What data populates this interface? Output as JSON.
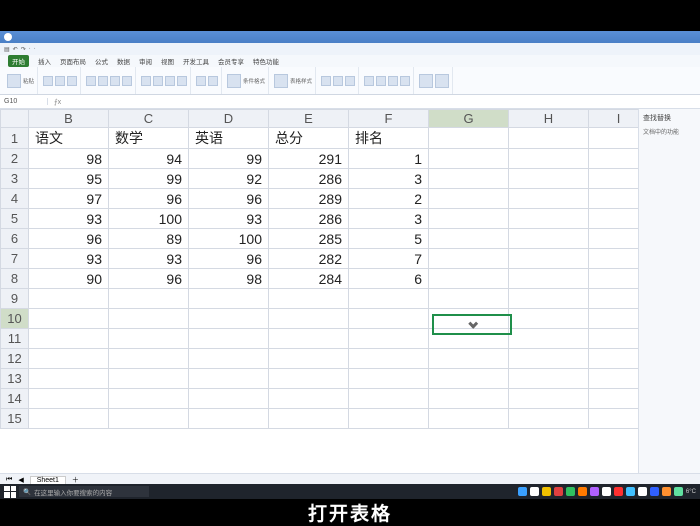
{
  "app": {
    "namebox": "G10",
    "formula": ""
  },
  "menus": [
    "开始",
    "插入",
    "页面布局",
    "公式",
    "数据",
    "审阅",
    "视图",
    "开发工具",
    "会员专享",
    "特色功能"
  ],
  "active_menu_index": 0,
  "columns": [
    "B",
    "C",
    "D",
    "E",
    "F",
    "G",
    "H",
    "I"
  ],
  "selected_col_index": 5,
  "headers": {
    "B": "语文",
    "C": "数学",
    "D": "英语",
    "E": "总分",
    "F": "排名"
  },
  "rows": [
    {
      "n": 1,
      "cells": [
        "语文",
        "数学",
        "英语",
        "总分",
        "排名",
        "",
        "",
        ""
      ],
      "txt": true
    },
    {
      "n": 2,
      "cells": [
        98,
        94,
        99,
        291,
        1,
        "",
        "",
        ""
      ]
    },
    {
      "n": 3,
      "cells": [
        95,
        99,
        92,
        286,
        3,
        "",
        "",
        ""
      ]
    },
    {
      "n": 4,
      "cells": [
        97,
        96,
        96,
        289,
        2,
        "",
        "",
        ""
      ]
    },
    {
      "n": 5,
      "cells": [
        93,
        100,
        93,
        286,
        3,
        "",
        "",
        ""
      ]
    },
    {
      "n": 6,
      "cells": [
        96,
        89,
        100,
        285,
        5,
        "",
        "",
        ""
      ]
    },
    {
      "n": 7,
      "cells": [
        93,
        93,
        96,
        282,
        7,
        "",
        "",
        ""
      ]
    },
    {
      "n": 8,
      "cells": [
        90,
        96,
        98,
        284,
        6,
        "",
        "",
        ""
      ]
    },
    {
      "n": 9,
      "cells": [
        "",
        "",
        "",
        "",
        "",
        "",
        "",
        ""
      ]
    },
    {
      "n": 10,
      "cells": [
        "",
        "",
        "",
        "",
        "",
        "",
        "",
        ""
      ],
      "active": true
    },
    {
      "n": 11,
      "cells": [
        "",
        "",
        "",
        "",
        "",
        "",
        "",
        ""
      ]
    },
    {
      "n": 12,
      "cells": [
        "",
        "",
        "",
        "",
        "",
        "",
        "",
        ""
      ]
    },
    {
      "n": 13,
      "cells": [
        "",
        "",
        "",
        "",
        "",
        "",
        "",
        ""
      ]
    },
    {
      "n": 14,
      "cells": [
        "",
        "",
        "",
        "",
        "",
        "",
        "",
        ""
      ]
    },
    {
      "n": 15,
      "cells": [
        "",
        "",
        "",
        "",
        "",
        "",
        "",
        ""
      ]
    }
  ],
  "chart_data": {
    "type": "table",
    "columns": [
      "语文",
      "数学",
      "英语",
      "总分",
      "排名"
    ],
    "data": [
      [
        98,
        94,
        99,
        291,
        1
      ],
      [
        95,
        99,
        92,
        286,
        3
      ],
      [
        97,
        96,
        96,
        289,
        2
      ],
      [
        93,
        100,
        93,
        286,
        3
      ],
      [
        96,
        89,
        100,
        285,
        5
      ],
      [
        93,
        93,
        96,
        282,
        7
      ],
      [
        90,
        96,
        98,
        284,
        6
      ]
    ]
  },
  "sheet_tab": "Sheet1",
  "side": {
    "title": "查找替换",
    "sub": "文档中的功能"
  },
  "taskbar": {
    "search_placeholder": "在这里输入你要搜索的内容",
    "temp": "6°C",
    "icon_colors": [
      "#3aa0ff",
      "#ffffff",
      "#f0c000",
      "#e04040",
      "#30c060",
      "#ff7a00",
      "#b060ff",
      "#ffffff",
      "#ff3030",
      "#40c0ff",
      "#ffffff",
      "#3060ff",
      "#ff9030",
      "#60e0a0"
    ]
  },
  "caption": "打开表格",
  "active_cell": "G10"
}
